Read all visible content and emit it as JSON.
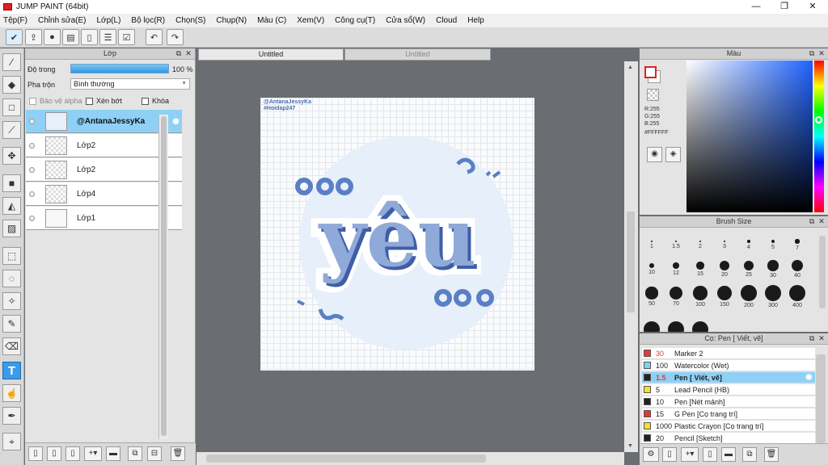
{
  "app": {
    "title": "JUMP PAINT (64bit)"
  },
  "window_controls": {
    "minimize": "—",
    "maximize": "❐",
    "close": "✕"
  },
  "menu": [
    "Tệp(F)",
    "Chỉnh sửa(E)",
    "Lớp(L)",
    "Bộ lọc(R)",
    "Chọn(S)",
    "Chụp(N)",
    "Màu (C)",
    "Xem(V)",
    "Công cụ(T)",
    "Cửa sổ(W)",
    "Cloud",
    "Help"
  ],
  "layer_panel": {
    "title": "Lớp",
    "opacity_label": "Độ trong",
    "opacity_value": "100 %",
    "opacity": 1.0,
    "blend_label": "Pha trộn",
    "blend_value": "Bình thường",
    "protect_alpha": "Bảo vệ alpha",
    "clipping": "Xén bớt",
    "lock": "Khóa",
    "layers": [
      {
        "name": "@AntanaJessyKa",
        "active": true
      },
      {
        "name": "Lớp2",
        "active": false
      },
      {
        "name": "Lớp2",
        "active": false
      },
      {
        "name": "Lớp4",
        "active": false
      },
      {
        "name": "Lớp1",
        "active": false
      }
    ]
  },
  "tabs": [
    {
      "label": "Untitled",
      "active": true
    },
    {
      "label": "Untitled",
      "active": false
    }
  ],
  "canvas": {
    "watermark_line1": "@AntanaJessyKa",
    "watermark_line2": "#Hoidap247",
    "art_text": "yêu",
    "accent_color": "#5a7fc4",
    "bg_circle_color": "#e6effa"
  },
  "color_panel": {
    "title": "Màu",
    "r": "R:255",
    "g": "G:255",
    "b": "B:255",
    "hex": "#FFFFFF",
    "primary_color": "#ffffff",
    "secondary_color": "#ffffff"
  },
  "brush_size": {
    "title": "Brush Size",
    "sizes": [
      "1",
      "1.5",
      "2",
      "3",
      "4",
      "5",
      "7",
      "10",
      "12",
      "15",
      "20",
      "25",
      "30",
      "40",
      "50",
      "70",
      "100",
      "150",
      "200",
      "300",
      "400"
    ]
  },
  "pencil_panel": {
    "title": "Cọ: Pen [ Viết, vẽ]",
    "items": [
      {
        "size": "30",
        "name": "Marker 2",
        "color": "#e53935",
        "red_size": true
      },
      {
        "size": "100",
        "name": "Watercolor (Wet)",
        "color": "#7fd3f5",
        "red_size": false
      },
      {
        "size": "1.5",
        "name": "Pen [ Viết, vẽ]",
        "color": "#222222",
        "red_size": true,
        "active": true
      },
      {
        "size": "5",
        "name": "Lead Pencil (HB)",
        "color": "#f5e12a",
        "red_size": false
      },
      {
        "size": "10",
        "name": "Pen [Nét mảnh]",
        "color": "#222222",
        "red_size": false
      },
      {
        "size": "15",
        "name": "G Pen [Cọ trang trí]",
        "color": "#e53935",
        "red_size": false
      },
      {
        "size": "1000",
        "name": "Plastic Crayon [Cọ trang trí]",
        "color": "#f5e12a",
        "red_size": false
      },
      {
        "size": "20",
        "name": "Pencil [Sketch]",
        "color": "#222222",
        "red_size": false
      }
    ]
  }
}
